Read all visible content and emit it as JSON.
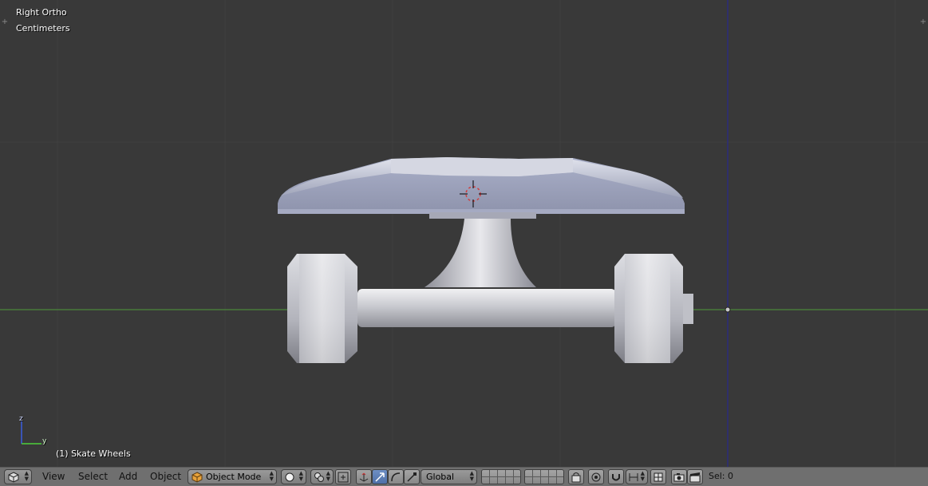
{
  "viewport": {
    "view_name": "Right Ortho",
    "units": "Centimeters",
    "active_object": "(1) Skate Wheels",
    "axis_z": "z",
    "axis_y": "y",
    "colors": {
      "background": "#393939",
      "y_axis": "#4e9a3a",
      "z_axis": "#2c2c7a",
      "mesh": "#b9bfd6"
    }
  },
  "header": {
    "menus": [
      "View",
      "Select",
      "Add",
      "Object"
    ],
    "mode": "Object Mode",
    "orientation": "Global",
    "selection_status": "Sel: 0"
  },
  "icons": {
    "editor_type": "cube-icon",
    "mode": "orange-cube-icon",
    "shading": "solid-sphere-icon",
    "pivot": "pivot-point-icon",
    "manipulator": "transform-manipulator-icon"
  }
}
